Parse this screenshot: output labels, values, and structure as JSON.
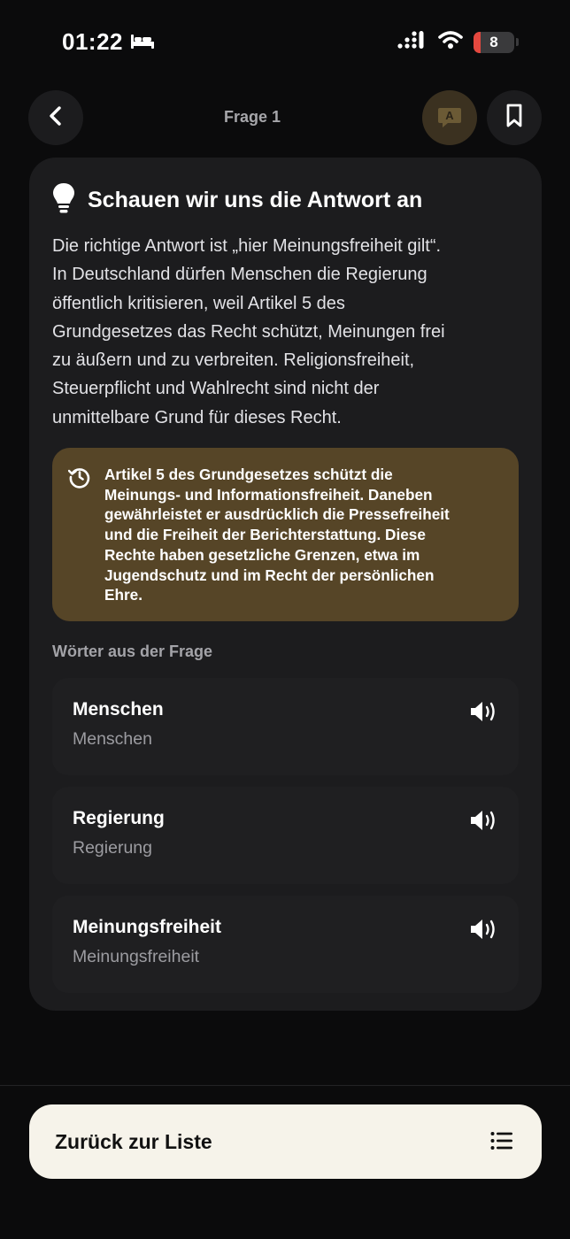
{
  "status": {
    "time": "01:22",
    "battery": "8"
  },
  "nav": {
    "title": "Frage 1",
    "translate_glyph": "A"
  },
  "card": {
    "title": "Schauen wir uns die Antwort an",
    "explanation_lines": [
      "Die richtige Antwort ist „hier Meinungsfreiheit gilt“.",
      "In Deutschland dürfen Menschen die Regierung",
      "öffentlich kritisieren, weil Artikel 5 des",
      "Grundgesetzes das Recht schützt, Meinungen frei",
      "zu äußern und zu verbreiten. Religionsfreiheit,",
      "Steuerpflicht und Wahlrecht sind nicht der",
      "unmittelbare Grund für dieses Recht."
    ],
    "note_lines": [
      "Artikel 5 des Grundgesetzes schützt die",
      "Meinungs- und Informationsfreiheit. Daneben",
      "gewährleistet er ausdrücklich die Pressefreiheit",
      "und die Freiheit der Berichterstattung. Diese",
      "Rechte haben gesetzliche Grenzen, etwa im",
      "Jugendschutz und im Recht der persönlichen",
      "Ehre."
    ],
    "words_heading": "Wörter aus der Frage",
    "words": [
      {
        "word": "Menschen",
        "translation": "Menschen"
      },
      {
        "word": "Regierung",
        "translation": "Regierung"
      },
      {
        "word": "Meinungsfreiheit",
        "translation": "Meinungsfreiheit"
      }
    ]
  },
  "footer": {
    "back_label": "Zurück zur Liste"
  },
  "icons": {
    "back": "chevron-left-icon",
    "translate": "translate-icon",
    "bookmark": "bookmark-icon",
    "title": "lightbulb-icon",
    "note": "history-icon",
    "speaker": "speaker-icon",
    "list": "list-icon"
  },
  "colors": {
    "background": "#0b0b0c",
    "card": "#1c1c1e",
    "note": "#564527",
    "translate_button": "#3b3120",
    "footer_button": "#f6f3ea",
    "battery_low": "#e5483f"
  }
}
